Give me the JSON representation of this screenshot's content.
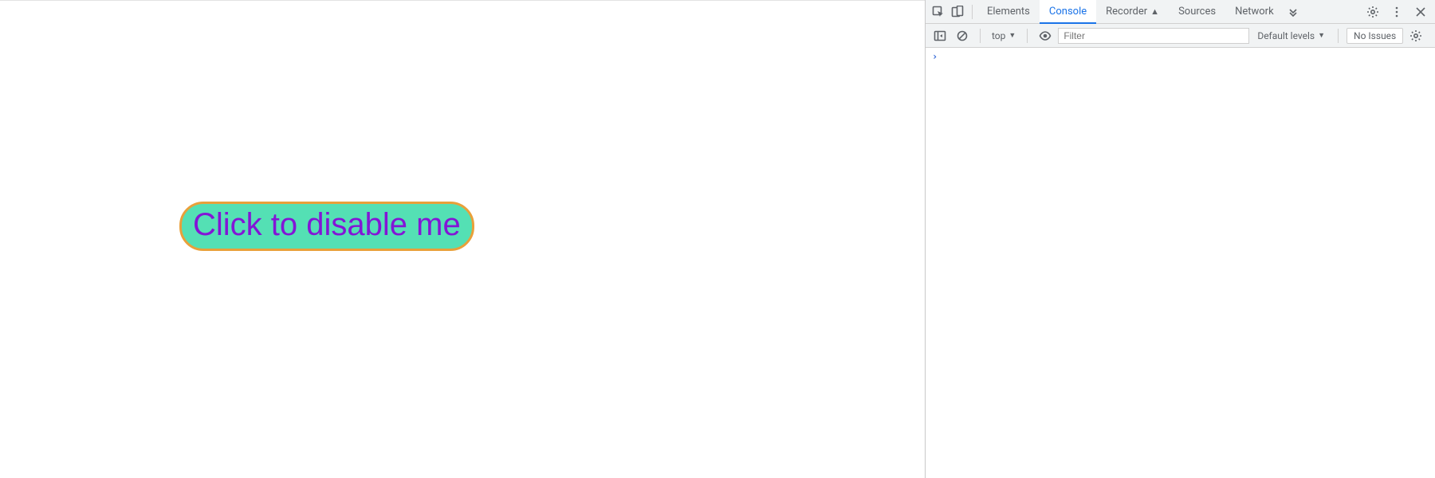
{
  "page": {
    "button_label": "Click to disable me"
  },
  "devtools": {
    "tabs": {
      "elements": "Elements",
      "console": "Console",
      "recorder": "Recorder",
      "sources": "Sources",
      "network": "Network"
    },
    "console_toolbar": {
      "context": "top",
      "filter_placeholder": "Filter",
      "levels": "Default levels",
      "issues": "No Issues"
    },
    "prompt": "›"
  }
}
